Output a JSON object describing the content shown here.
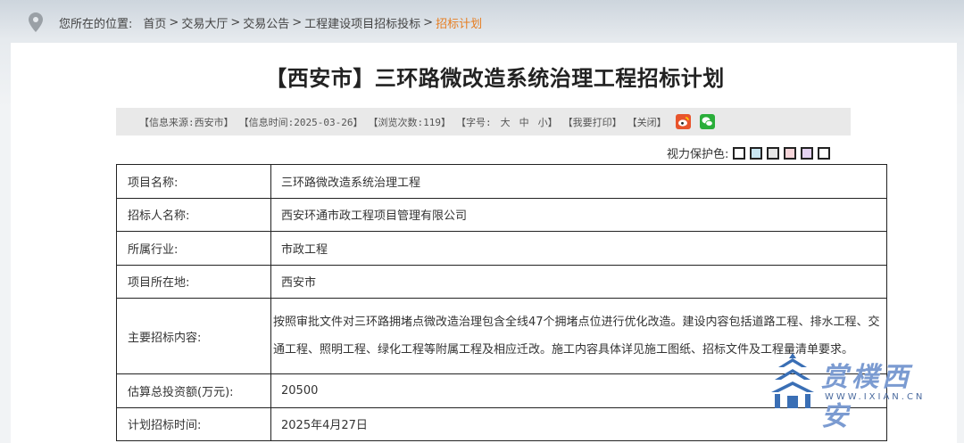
{
  "breadcrumb": {
    "label": "您所在的位置:",
    "items": [
      "首页",
      "交易大厅",
      "交易公告",
      "工程建设项目招标投标"
    ],
    "separator": ">",
    "current": "招标计划"
  },
  "article": {
    "title": "【西安市】三环路微改造系统治理工程招标计划",
    "meta": {
      "source": "【信息来源:西安市】",
      "time": "【信息时间:2025-03-26】",
      "views": "【浏览次数:119】",
      "font_size_label": "【字号:",
      "font_large": "大",
      "font_medium": "中",
      "font_small": "小】",
      "print": "【我要打印】",
      "close": "【关闭】"
    },
    "eye_protection_label": "视力保护色:",
    "eye_colors": [
      "#ffffff",
      "#c9e6f2",
      "#e6e6e6",
      "#f7d6da",
      "#e4d2f0",
      "#ffffff"
    ]
  },
  "table": [
    {
      "key": "项目名称:",
      "value": "三环路微改造系统治理工程"
    },
    {
      "key": "招标人名称:",
      "value": "西安环通市政工程项目管理有限公司"
    },
    {
      "key": "所属行业:",
      "value": "市政工程"
    },
    {
      "key": "项目所在地:",
      "value": "西安市"
    },
    {
      "key": "主要招标内容:",
      "value": "按照审批文件对三环路拥堵点微改造治理包含全线47个拥堵点位进行优化改造。建设内容包括道路工程、排水工程、交通工程、照明工程、绿化工程等附属工程及相应迁改。施工内容具体详见施工图纸、招标文件及工程量清单要求。"
    },
    {
      "key": "估算总投资额(万元):",
      "value": "20500"
    },
    {
      "key": "计划招标时间:",
      "value": "2025年4月27日"
    }
  ],
  "watermark": {
    "text": "赏樸西安",
    "url": "WWW.IXIAN.CN"
  },
  "colors": {
    "accent": "#e67e22",
    "weibo": "#e8542c",
    "wechat": "#2aae3a",
    "watermark": "#7b9bd1"
  }
}
